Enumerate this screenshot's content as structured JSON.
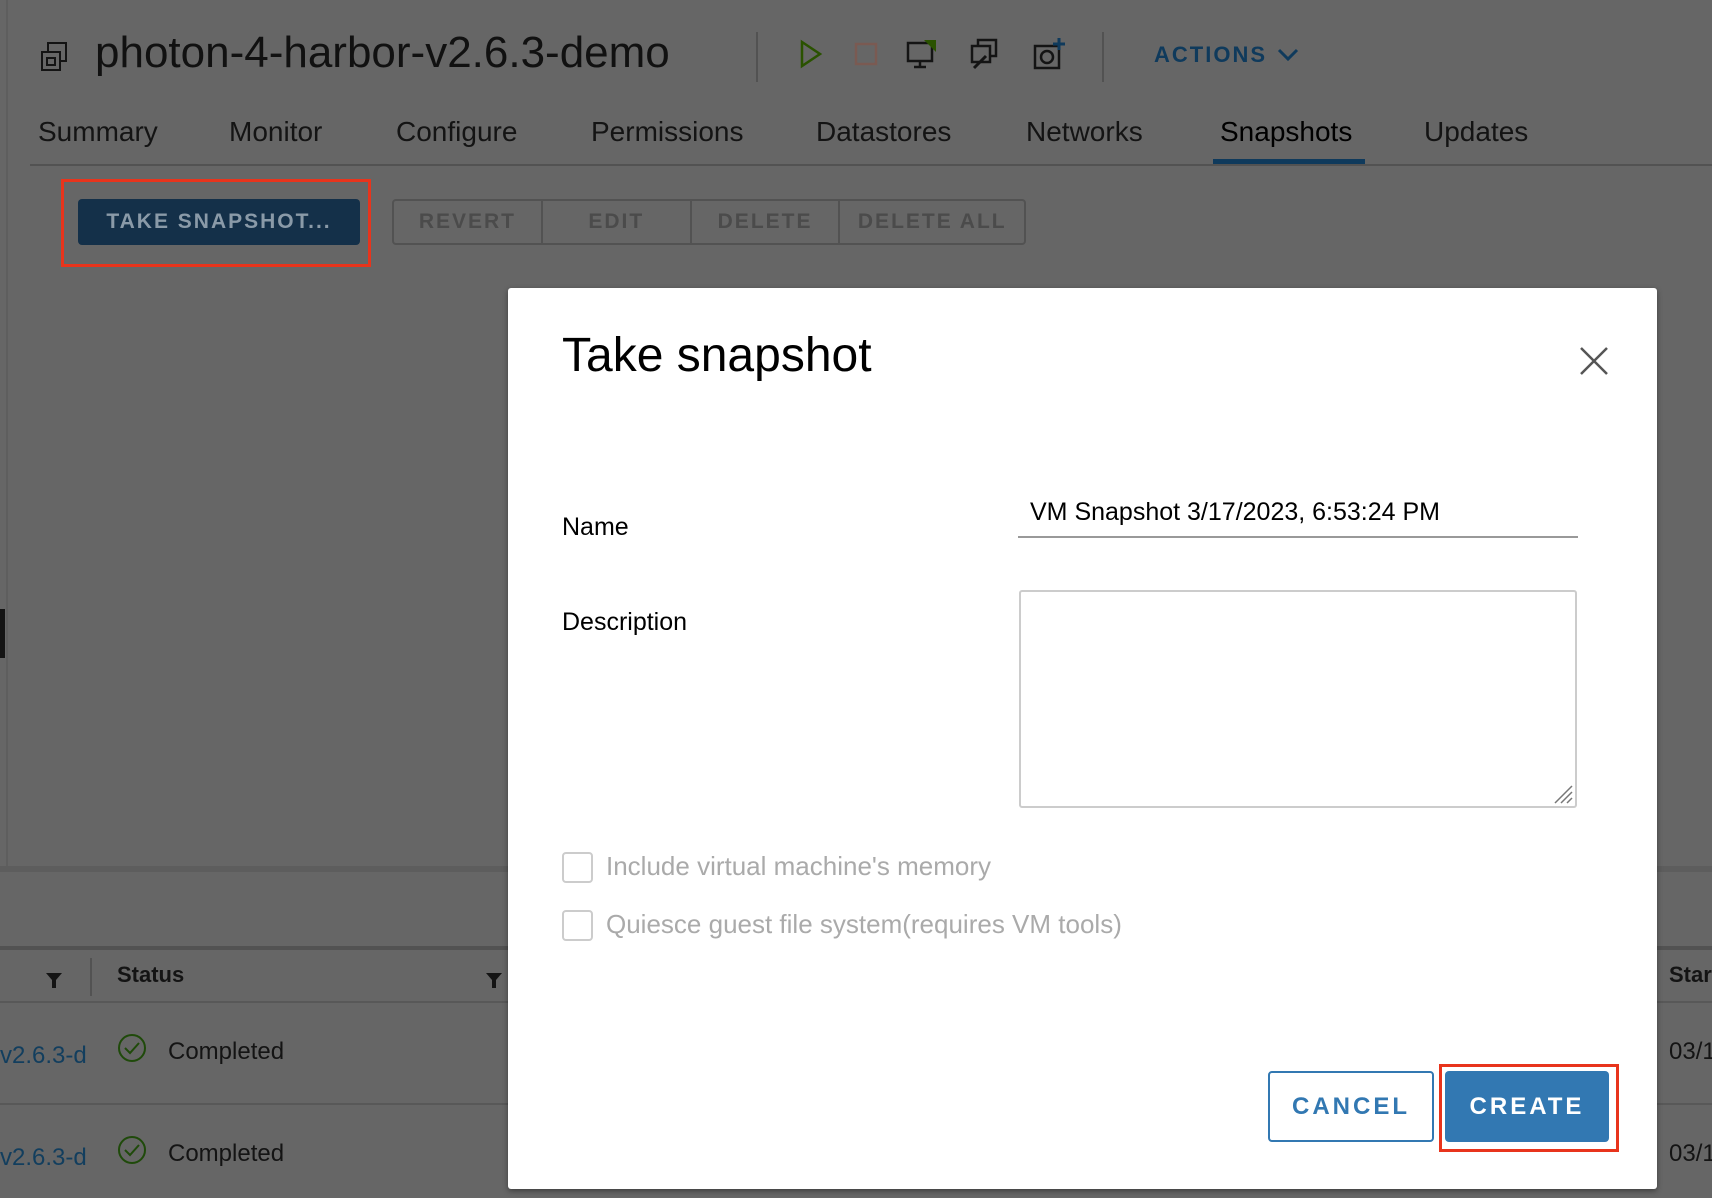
{
  "header": {
    "title": "photon-4-harbor-v2.6.3-demo",
    "actions_label": "ACTIONS",
    "icons": [
      "vm-icon",
      "power-on-icon",
      "power-off-icon",
      "launch-console-icon",
      "migrate-icon",
      "snapshot-icon"
    ]
  },
  "tabs": [
    {
      "label": "Summary"
    },
    {
      "label": "Monitor"
    },
    {
      "label": "Configure"
    },
    {
      "label": "Permissions"
    },
    {
      "label": "Datastores"
    },
    {
      "label": "Networks"
    },
    {
      "label": "Snapshots",
      "active": true
    },
    {
      "label": "Updates"
    }
  ],
  "toolbar": {
    "take_snapshot": "TAKE SNAPSHOT...",
    "revert": "REVERT",
    "edit": "EDIT",
    "delete": "DELETE",
    "delete_all": "DELETE ALL"
  },
  "tasks": {
    "columns": [
      "Status",
      "Star"
    ],
    "rows": [
      {
        "target": "v2.6.3-d",
        "status": "Completed",
        "start": "03/1"
      },
      {
        "target": "v2.6.3-d",
        "status": "Completed",
        "start": "03/1"
      }
    ]
  },
  "dialog": {
    "title": "Take snapshot",
    "name_label": "Name",
    "name_value": "VM Snapshot 3/17/2023, 6:53:24 PM",
    "description_label": "Description",
    "description_value": "",
    "memory_label": "Include virtual machine's memory",
    "quiesce_label": "Quiesce guest file system(requires VM tools)",
    "cancel": "CANCEL",
    "create": "CREATE"
  },
  "colors": {
    "accent": "#0072a3",
    "highlight": "#e8341c",
    "success": "#2f8400"
  }
}
